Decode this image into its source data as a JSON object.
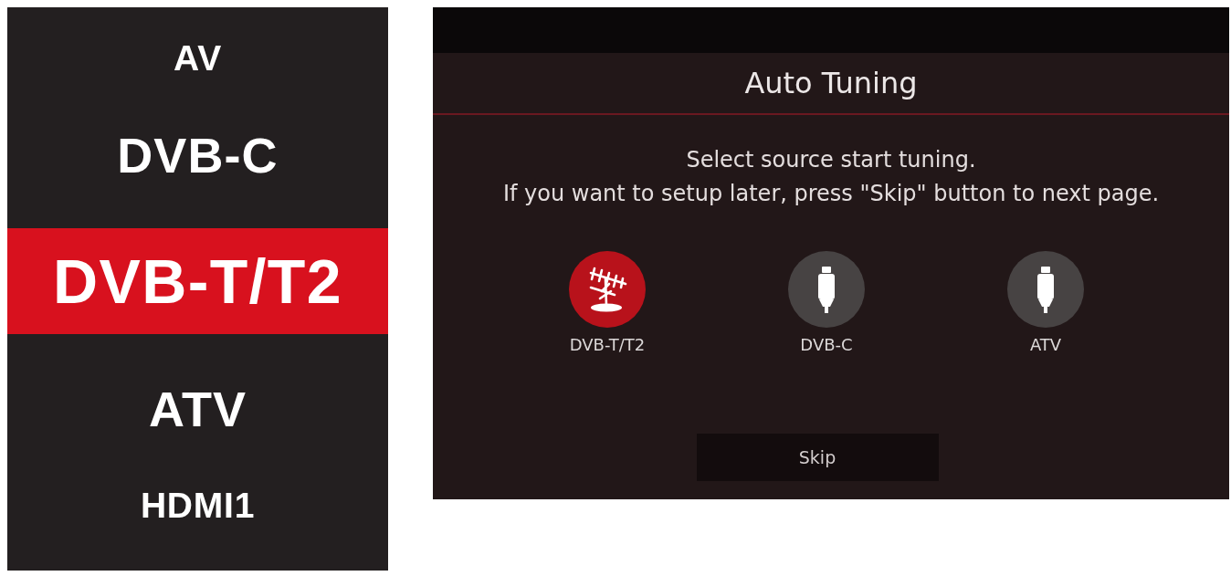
{
  "source_list": {
    "items": [
      {
        "label": "AV",
        "selected": false
      },
      {
        "label": "DVB-C",
        "selected": false
      },
      {
        "label": "DVB-T/T2",
        "selected": true
      },
      {
        "label": "ATV",
        "selected": false
      },
      {
        "label": "HDMI1",
        "selected": false
      }
    ]
  },
  "dialog": {
    "title": "Auto Tuning",
    "message": [
      "Select source start tuning.",
      "If you want to setup later, press \"Skip\" button to next page."
    ],
    "sources": [
      {
        "label": "DVB-T/T2",
        "kind": "antenna",
        "selected": true
      },
      {
        "label": "DVB-C",
        "kind": "cable",
        "selected": false
      },
      {
        "label": "ATV",
        "kind": "cable",
        "selected": false
      }
    ],
    "skip_button": "Skip"
  }
}
